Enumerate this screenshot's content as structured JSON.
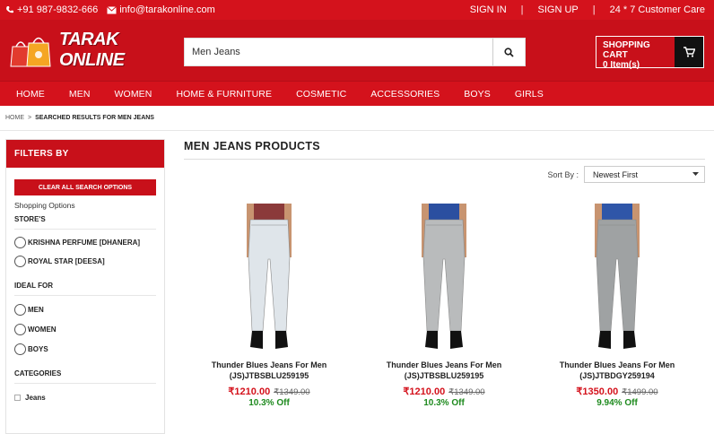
{
  "topbar": {
    "phone": "+91 987-9832-666",
    "email": "info@tarakonline.com",
    "sign_in": "SIGN IN",
    "sign_up": "SIGN UP",
    "care": "24 * 7 Customer Care"
  },
  "brand": {
    "name": "TARAK ONLINE"
  },
  "search": {
    "value": "Men Jeans"
  },
  "cart": {
    "label": "SHOPPING CART",
    "count": "0 Item(s)"
  },
  "nav": [
    "HOME",
    "MEN",
    "WOMEN",
    "HOME & FURNITURE",
    "COSMETIC",
    "ACCESSORIES",
    "BOYS",
    "GIRLS"
  ],
  "breadcrumb": {
    "home": "HOME",
    "sep": ">",
    "current": "SEARCHED RESULTS FOR MEN JEANS"
  },
  "filters": {
    "title": "FILTERS BY",
    "clear": "CLEAR ALL SEARCH OPTIONS",
    "shopping_options": "Shopping Options",
    "stores_title": "STORE'S",
    "stores": [
      "KRISHNA PERFUME [DHANERA]",
      "ROYAL STAR [DEESA]"
    ],
    "ideal_title": "IDEAL FOR",
    "ideal": [
      "MEN",
      "WOMEN",
      "BOYS"
    ],
    "categories_title": "CATEGORIES",
    "categories": [
      "Jeans"
    ]
  },
  "main": {
    "title": "MEN JEANS PRODUCTS",
    "sort_label": "Sort By :",
    "sort_value": "Newest First"
  },
  "products": [
    {
      "name1": "Thunder Blues Jeans For Men",
      "name2": "(JS)JTBSBLU259195",
      "price": "₹1210.00",
      "old": "₹1349.00",
      "off": "10.3% Off",
      "jean_color": "#dfe5ea",
      "shirt_color": "#8b3a3a"
    },
    {
      "name1": "Thunder Blues Jeans For Men",
      "name2": "(JS)JTBSBLU259195",
      "price": "₹1210.00",
      "old": "₹1349.00",
      "off": "10.3% Off",
      "jean_color": "#b9bbbc",
      "shirt_color": "#2b4fa0"
    },
    {
      "name1": "Thunder Blues Jeans For Men",
      "name2": "(JS)JTBDGY259194",
      "price": "₹1350.00",
      "old": "₹1499.00",
      "off": "9.94% Off",
      "jean_color": "#9fa2a3",
      "shirt_color": "#2f56a8"
    }
  ]
}
